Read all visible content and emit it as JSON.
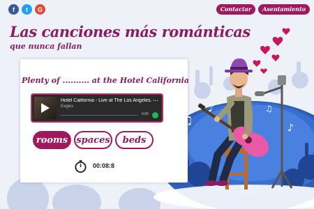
{
  "header": {
    "social": [
      {
        "name": "facebook-icon",
        "glyph": "f",
        "color": "#3b5998"
      },
      {
        "name": "twitter-icon",
        "glyph": "t",
        "color": "#1da1f2"
      },
      {
        "name": "google-plus-icon",
        "glyph": "G",
        "color": "#dd4b39"
      }
    ],
    "nav": [
      "Contactar",
      "Asentamiento"
    ]
  },
  "title": {
    "line1": "Las canciones más románticas",
    "line2": "que nunca fallan"
  },
  "question": "Plenty of .......... at the Hotel California",
  "player": {
    "track": "Hotel California - Live at The Los Angeles...",
    "artist": "Eagles",
    "time": "0:00",
    "more_icon": "more-dots-icon"
  },
  "options": [
    {
      "label": "rooms",
      "selected": true
    },
    {
      "label": "spaces",
      "selected": false
    },
    {
      "label": "beds",
      "selected": false
    }
  ],
  "timer": "00:08:8",
  "colors": {
    "accent": "#a0195c",
    "title": "#8a1c63",
    "spotlight": "#2f5fb8"
  }
}
